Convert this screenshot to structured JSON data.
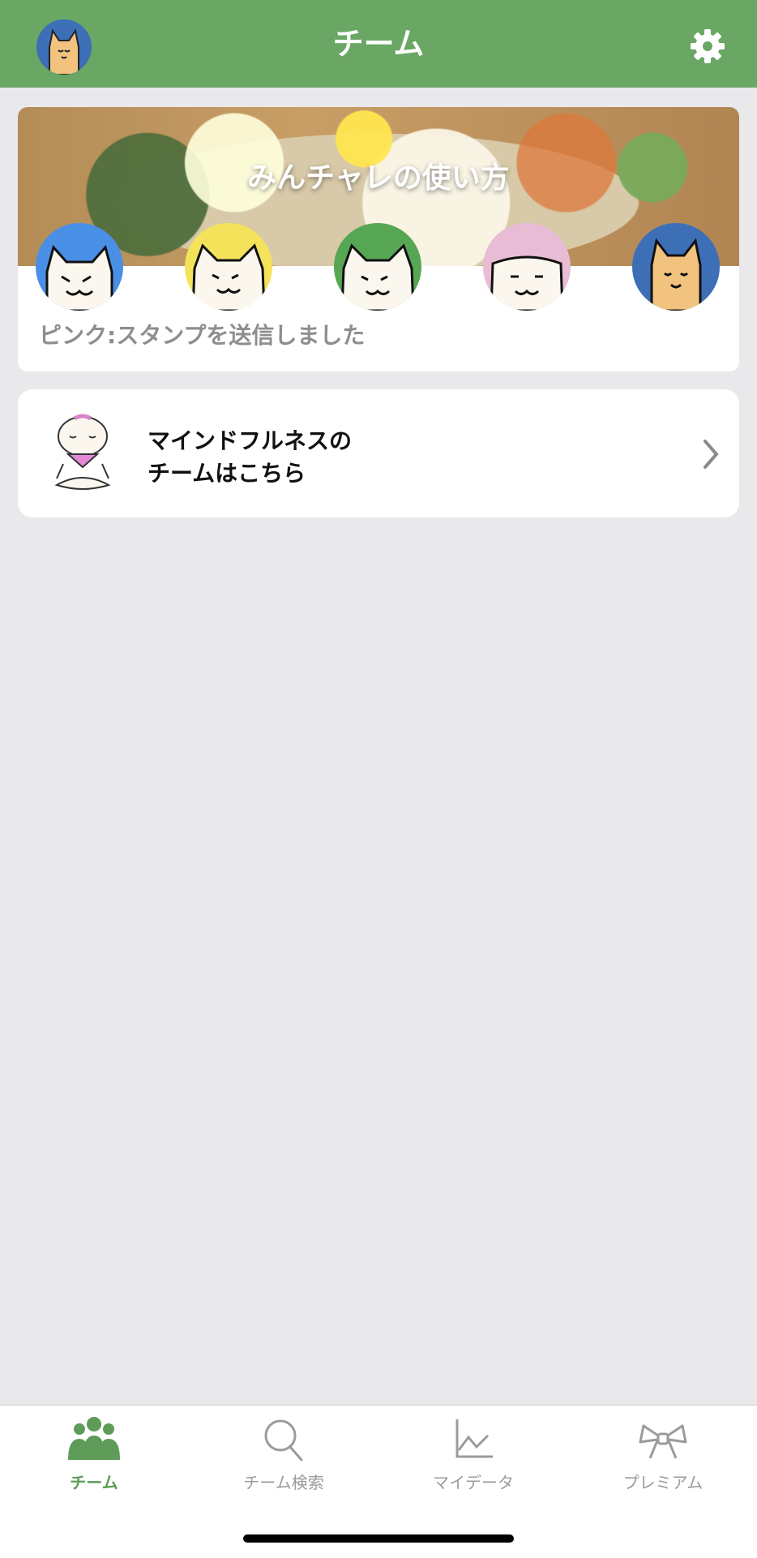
{
  "header": {
    "title": "チーム"
  },
  "team_card": {
    "banner_title": "みんチャレの使い方",
    "status": "ピンク:スタンプを送信しました",
    "members": [
      {
        "color": "#4a8fe6",
        "name": "member-blue"
      },
      {
        "color": "#f4e25a",
        "name": "member-yellow"
      },
      {
        "color": "#57a653",
        "name": "member-green"
      },
      {
        "color": "#e9bcd6",
        "name": "member-pink"
      },
      {
        "color": "#3d6fb6",
        "name": "member-me"
      }
    ]
  },
  "mindfulness": {
    "line1": "マインドフルネスの",
    "line2": "チームはこちら"
  },
  "tabs": [
    {
      "label": "チーム",
      "active": true
    },
    {
      "label": "チーム検索",
      "active": false
    },
    {
      "label": "マイデータ",
      "active": false
    },
    {
      "label": "プレミアム",
      "active": false
    }
  ]
}
